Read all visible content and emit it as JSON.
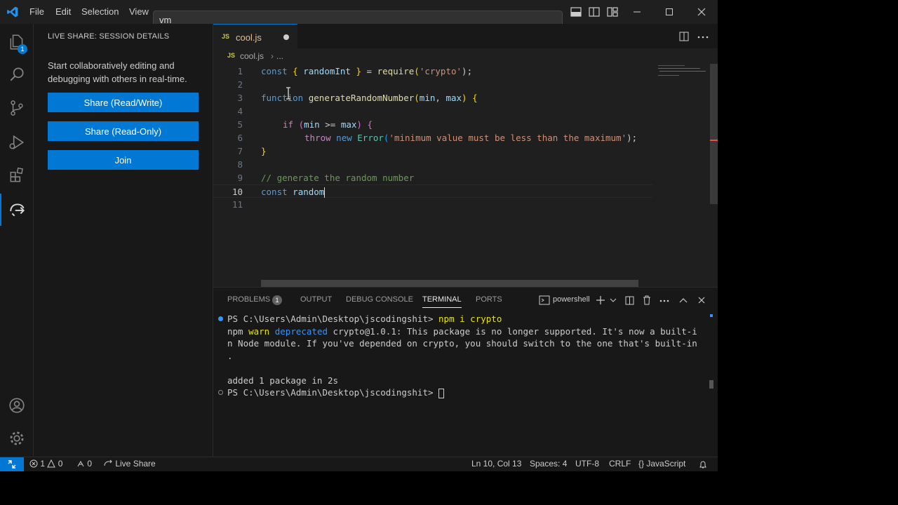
{
  "menu": {
    "file": "File",
    "edit": "Edit",
    "selection": "Selection",
    "view": "View"
  },
  "command_center": {
    "value": "vm"
  },
  "activity_bar": {
    "explorer_badge": "1"
  },
  "sidebar": {
    "title": "LIVE SHARE: SESSION DETAILS",
    "description": "Start collaboratively editing and debugging with others in real-time.",
    "buttons": [
      "Share (Read/Write)",
      "Share (Read-Only)",
      "Join"
    ]
  },
  "editor": {
    "tab_label": "cool.js",
    "breadcrumb_file": "cool.js",
    "breadcrumb_more": "...",
    "file_icon": "JS",
    "line_numbers": [
      "1",
      "2",
      "3",
      "4",
      "5",
      "6",
      "7",
      "8",
      "9",
      "10",
      "11"
    ],
    "code": {
      "l1": [
        "const",
        "{",
        " randomInt ",
        "}",
        " = ",
        "require",
        "(",
        "'crypto'",
        ");"
      ],
      "l3": [
        "function",
        " ",
        "generateRandomNumber",
        "(",
        "min",
        ", ",
        "max",
        ") ",
        "{"
      ],
      "l5": [
        "if",
        " (",
        "min",
        " >= ",
        "max",
        ") ",
        "{"
      ],
      "l6": [
        "throw",
        " ",
        "new",
        " ",
        "Error",
        "(",
        "'minimum value must be less than the maximum'",
        ");"
      ],
      "l7": [
        "}"
      ],
      "l9": [
        "// generate the random number"
      ],
      "l10": [
        "const",
        " random"
      ]
    }
  },
  "panel": {
    "tabs": [
      "PROBLEMS",
      "OUTPUT",
      "DEBUG CONSOLE",
      "TERMINAL",
      "PORTS"
    ],
    "problems_count": "1",
    "terminal_name": "powershell",
    "terminal": {
      "l1_prompt": "PS C:\\Users\\Admin\\Desktop\\jscodingshit> ",
      "l1_cmd": "npm i crypto",
      "l2_npm": "npm ",
      "l2_warn": "warn",
      "l2_dep": " deprecated",
      "l2_rest": " crypto@1.0.1: This package is no longer supported. It's now a built-i",
      "l3": "n Node module. If you've depended on crypto, you should switch to the one that's built-in",
      "l4": ".",
      "l5": "",
      "l6": "added 1 package in 2s",
      "l7_prompt": "PS C:\\Users\\Admin\\Desktop\\jscodingshit> "
    }
  },
  "status": {
    "errors": "1",
    "warnings": "0",
    "ports": "0",
    "live_share": "Live Share",
    "position": "Ln 10, Col 13",
    "spaces": "Spaces: 4",
    "encoding": "UTF-8",
    "eol": "CRLF",
    "language": "JavaScript"
  },
  "colors": {
    "accent": "#0078d4",
    "background": "#1f1f1f"
  }
}
